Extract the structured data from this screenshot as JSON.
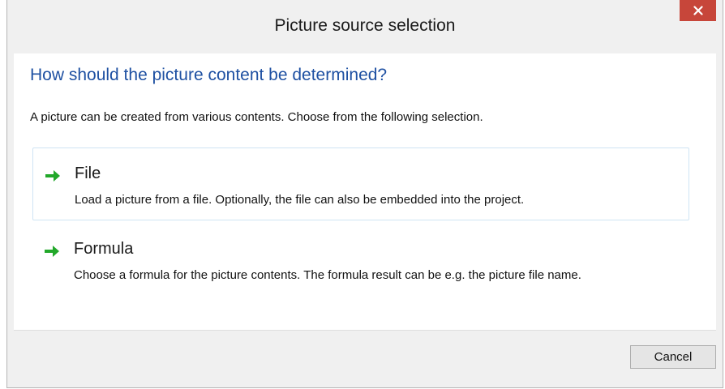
{
  "dialog": {
    "title": "Picture source selection",
    "close_icon": "close-icon",
    "heading": "How should the picture content be determined?",
    "description": "A picture can be created from various contents. Choose from the following selection.",
    "options": [
      {
        "title": "File",
        "description": "Load a picture from a file. Optionally, the file can also be embedded into the project.",
        "icon": "arrow-right-icon"
      },
      {
        "title": "Formula",
        "description": "Choose a formula for the picture contents. The formula result can be e.g. the picture file name.",
        "icon": "arrow-right-icon"
      }
    ],
    "cancel_label": "Cancel"
  },
  "colors": {
    "heading": "#1e50a2",
    "close_button": "#c7463a",
    "arrow": "#22a82a",
    "selected_border": "#cfe4f4"
  }
}
